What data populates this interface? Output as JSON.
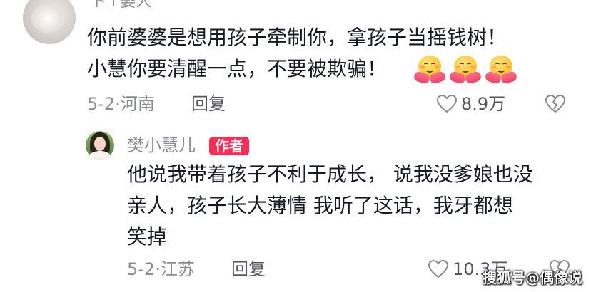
{
  "comment_top": {
    "username": "ド↑婆人",
    "lines": [
      "你前婆婆是想用孩子牵制你，拿孩子当摇钱树！",
      "小慧你要清醒一点，不要被欺骗！"
    ],
    "emojis": [
      "hugging-face-emoji",
      "hugging-face-emoji",
      "hugging-face-emoji"
    ],
    "date_location": "5-2·河南",
    "reply_label": "回复",
    "like_count": "8.9万"
  },
  "comment_reply": {
    "username": "樊小慧儿",
    "badge": "作者",
    "badge_color": "#fe2c55",
    "lines": [
      "他说我带着孩子不利于成长， 说我没爹娘也没",
      "亲人，孩子长大薄情  我听了这话，我牙都想",
      "笑掉"
    ],
    "date_location": "5-2·江苏",
    "reply_label": "回复",
    "like_count": "10.3万"
  },
  "watermark": "搜狐号@偶像说",
  "icons": [
    "heart-outline-icon",
    "dislike-heart-icon"
  ]
}
